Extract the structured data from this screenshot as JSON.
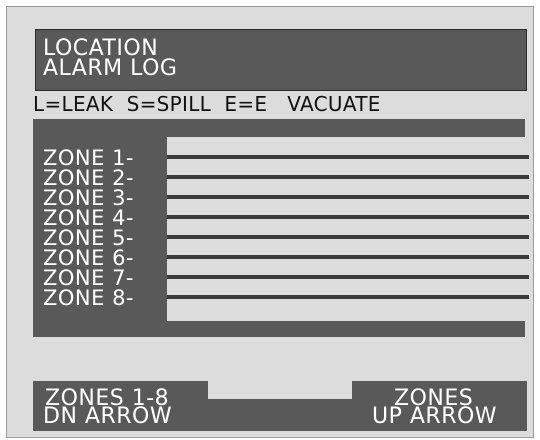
{
  "header": {
    "line1": "LOCATION",
    "line2": "ALARM LOG"
  },
  "legend": "L=LEAK  S=SPILL  E=E   VACUATE",
  "zones": [
    {
      "label": "ZONE 1-"
    },
    {
      "label": "ZONE 2-"
    },
    {
      "label": "ZONE 3-"
    },
    {
      "label": "ZONE 4-"
    },
    {
      "label": "ZONE 5-"
    },
    {
      "label": "ZONE 6-"
    },
    {
      "label": "ZONE 7-"
    },
    {
      "label": "ZONE 8-"
    }
  ],
  "buttons": {
    "down": {
      "line1": "ZONES 1-8",
      "line2": "DN ARROW"
    },
    "up": {
      "line1": "ZONES",
      "line2": "UP ARROW"
    }
  },
  "colors": {
    "panel": "#595959",
    "background": "#dcdcdc",
    "text_light": "#ffffff"
  }
}
